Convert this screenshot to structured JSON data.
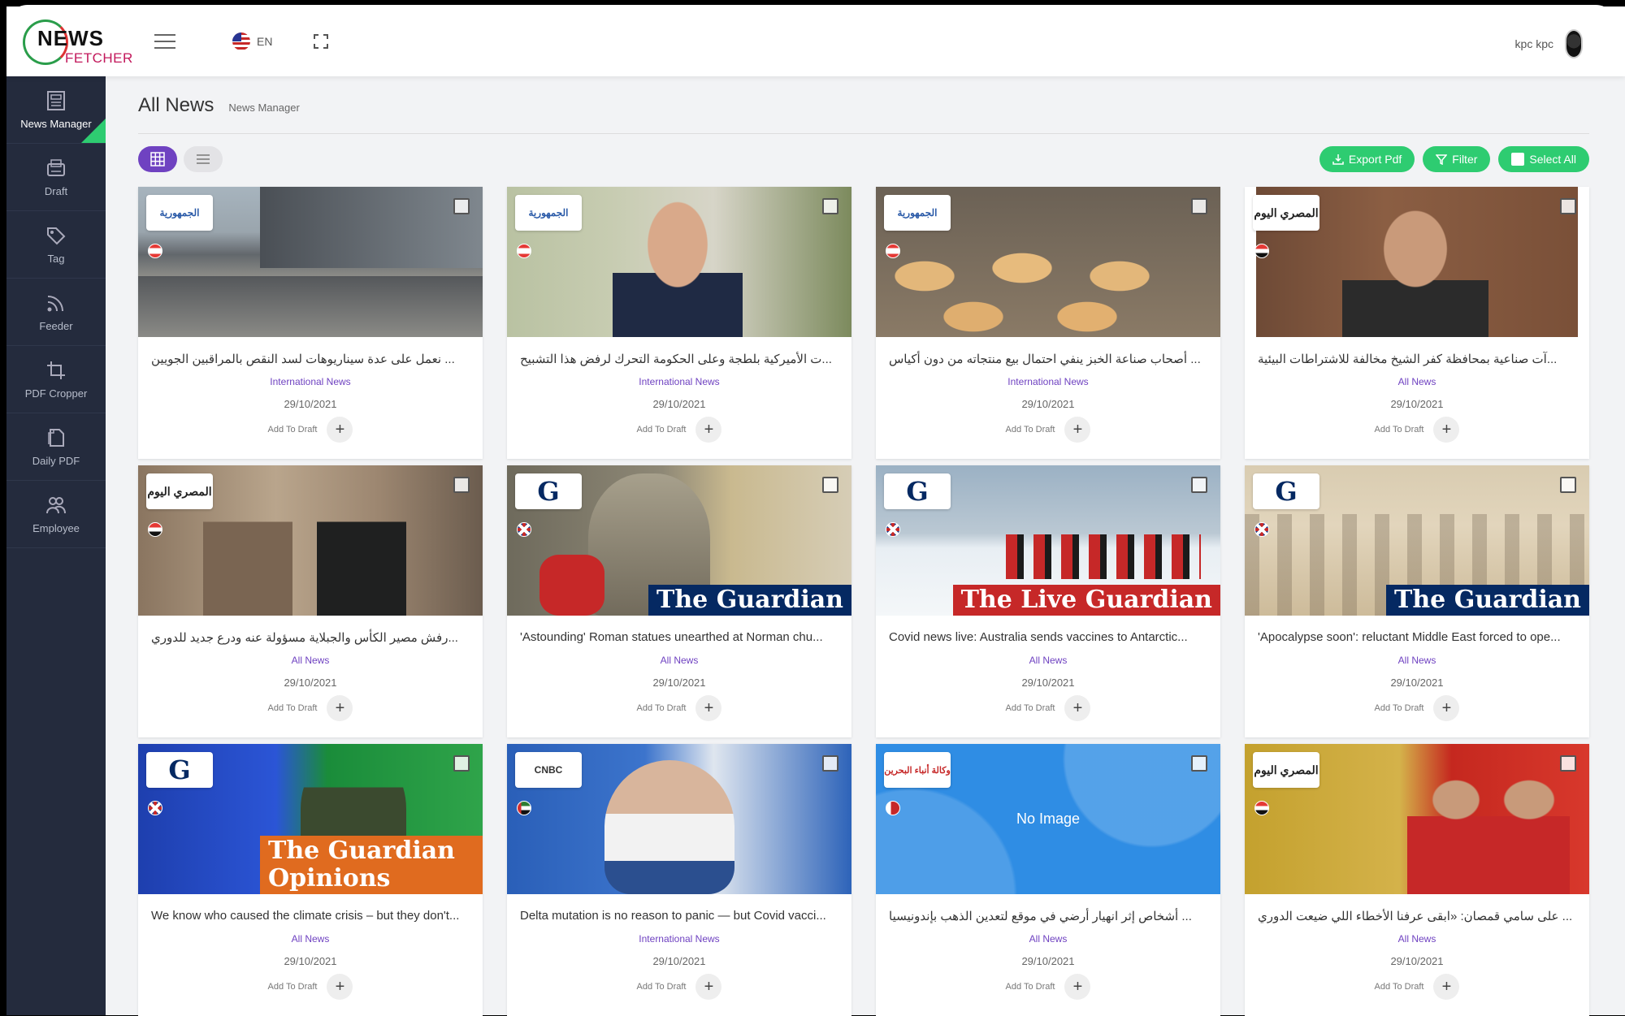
{
  "header": {
    "logo_top": "NEWS",
    "logo_bottom": "FETCHER",
    "language": "EN",
    "user_name": "kpc kpc"
  },
  "sidebar": {
    "items": [
      {
        "label": "News Manager",
        "icon": "news-icon"
      },
      {
        "label": "Draft",
        "icon": "draft-icon"
      },
      {
        "label": "Tag",
        "icon": "tag-icon"
      },
      {
        "label": "Feeder",
        "icon": "rss-icon"
      },
      {
        "label": "PDF Cropper",
        "icon": "crop-icon"
      },
      {
        "label": "Daily PDF",
        "icon": "file-icon"
      },
      {
        "label": "Employee",
        "icon": "users-icon"
      }
    ]
  },
  "page": {
    "title": "All News",
    "subtitle": "News Manager"
  },
  "toolbar": {
    "export_label": "Export Pdf",
    "filter_label": "Filter",
    "select_all_label": "Select All"
  },
  "card_common": {
    "add_to_draft": "Add To Draft",
    "plus": "+"
  },
  "cards": [
    {
      "title": "... نعمل على عدة سيناريوهات لسد النقص بالمراقبين الجويين",
      "category": "International News",
      "date": "29/10/2021",
      "source": "aljoumhouria",
      "flag": "lebanon"
    },
    {
      "title": "...ت الأميركية بلطجة وعلى الحكومة التحرك لرفض هذا التشبيح",
      "category": "International News",
      "date": "29/10/2021",
      "source": "aljoumhouria",
      "flag": "lebanon"
    },
    {
      "title": "... أصحاب صناعة الخبز ينفي احتمال بيع منتجاته من دون أكياس",
      "category": "International News",
      "date": "29/10/2021",
      "source": "aljoumhouria",
      "flag": "lebanon"
    },
    {
      "title": "...آت صناعية بمحافظة كفر الشيخ مخالفة للاشتراطات البيئية",
      "category": "All News",
      "date": "29/10/2021",
      "source": "almasry",
      "flag": "egypt"
    },
    {
      "title": "...رفش مصير الكأس والجبلاية مسؤولة عنه ودرع جديد للدوري",
      "category": "All News",
      "date": "29/10/2021",
      "source": "almasry",
      "flag": "egypt"
    },
    {
      "title": "'Astounding' Roman statues unearthed at Norman chu...",
      "category": "All News",
      "date": "29/10/2021",
      "source": "guardian",
      "flag": "uk"
    },
    {
      "title": "Covid news live: Australia sends vaccines to Antarctic...",
      "category": "All News",
      "date": "29/10/2021",
      "source": "guardian",
      "flag": "uk"
    },
    {
      "title": "'Apocalypse soon': reluctant Middle East forced to ope...",
      "category": "All News",
      "date": "29/10/2021",
      "source": "guardian",
      "flag": "uk"
    },
    {
      "title": "We know who caused the climate crisis – but they don't...",
      "category": "All News",
      "date": "29/10/2021",
      "source": "guardian",
      "flag": "uk"
    },
    {
      "title": "Delta mutation is no reason to panic — but Covid vacci...",
      "category": "International News",
      "date": "29/10/2021",
      "source": "cnbc",
      "flag": "uae"
    },
    {
      "title": "... أشخاص إثر انهيار أرضي في موقع لتعدين الذهب بإندونيسيا",
      "category": "All News",
      "date": "29/10/2021",
      "source": "bna",
      "flag": "bahrain"
    },
    {
      "title": "... على سامي قمصان: «ابقى عرفنا الأخطاء اللي ضيعت الدوري",
      "category": "All News",
      "date": "29/10/2021",
      "source": "almasry",
      "flag": "egypt"
    }
  ],
  "source_logos": {
    "guardian": "G",
    "almasry": "المصري اليوم",
    "aljoumhouria": "الجمهورية",
    "cnbc": "CNBC",
    "bna": "وكالة أنباء البحرين"
  },
  "watermarks": [
    "The Guardian",
    "The Guardian",
    "The Live Guardian",
    "The Guardian",
    "The Guardian Opinions"
  ],
  "no_image_label": "No Image",
  "colors": {
    "sidebar_bg": "#242b3d",
    "accent_green": "#2ecc71",
    "accent_purple": "#6f42c1"
  }
}
